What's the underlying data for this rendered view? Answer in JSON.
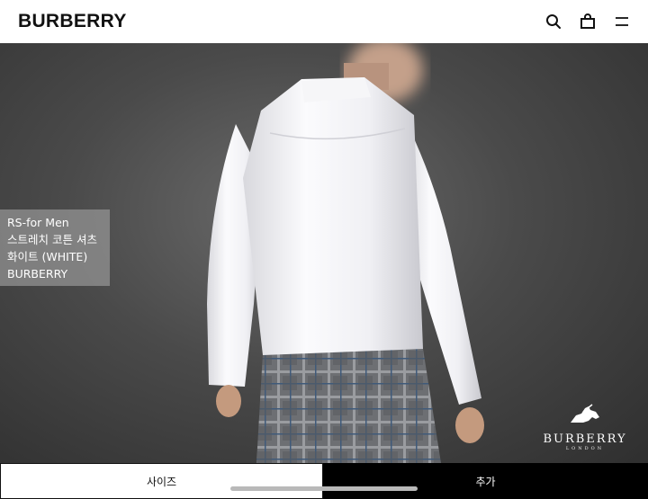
{
  "header": {
    "brand": "BURBERRY",
    "icons": [
      "search-icon",
      "bag-icon",
      "menu-icon"
    ]
  },
  "hero": {
    "caption_lines": [
      "RS-for Men",
      "스트레치 코튼 셔츠",
      "화이트 (WHITE)",
      "BURBERRY"
    ],
    "logo_word": "BURBERRY",
    "logo_sub": "LONDON"
  },
  "actions": {
    "size_label": "사이즈",
    "add_label": "추가"
  },
  "colors": {
    "header_bg": "#ffffff",
    "primary": "#000000",
    "backdrop": "#4a4a4a"
  }
}
